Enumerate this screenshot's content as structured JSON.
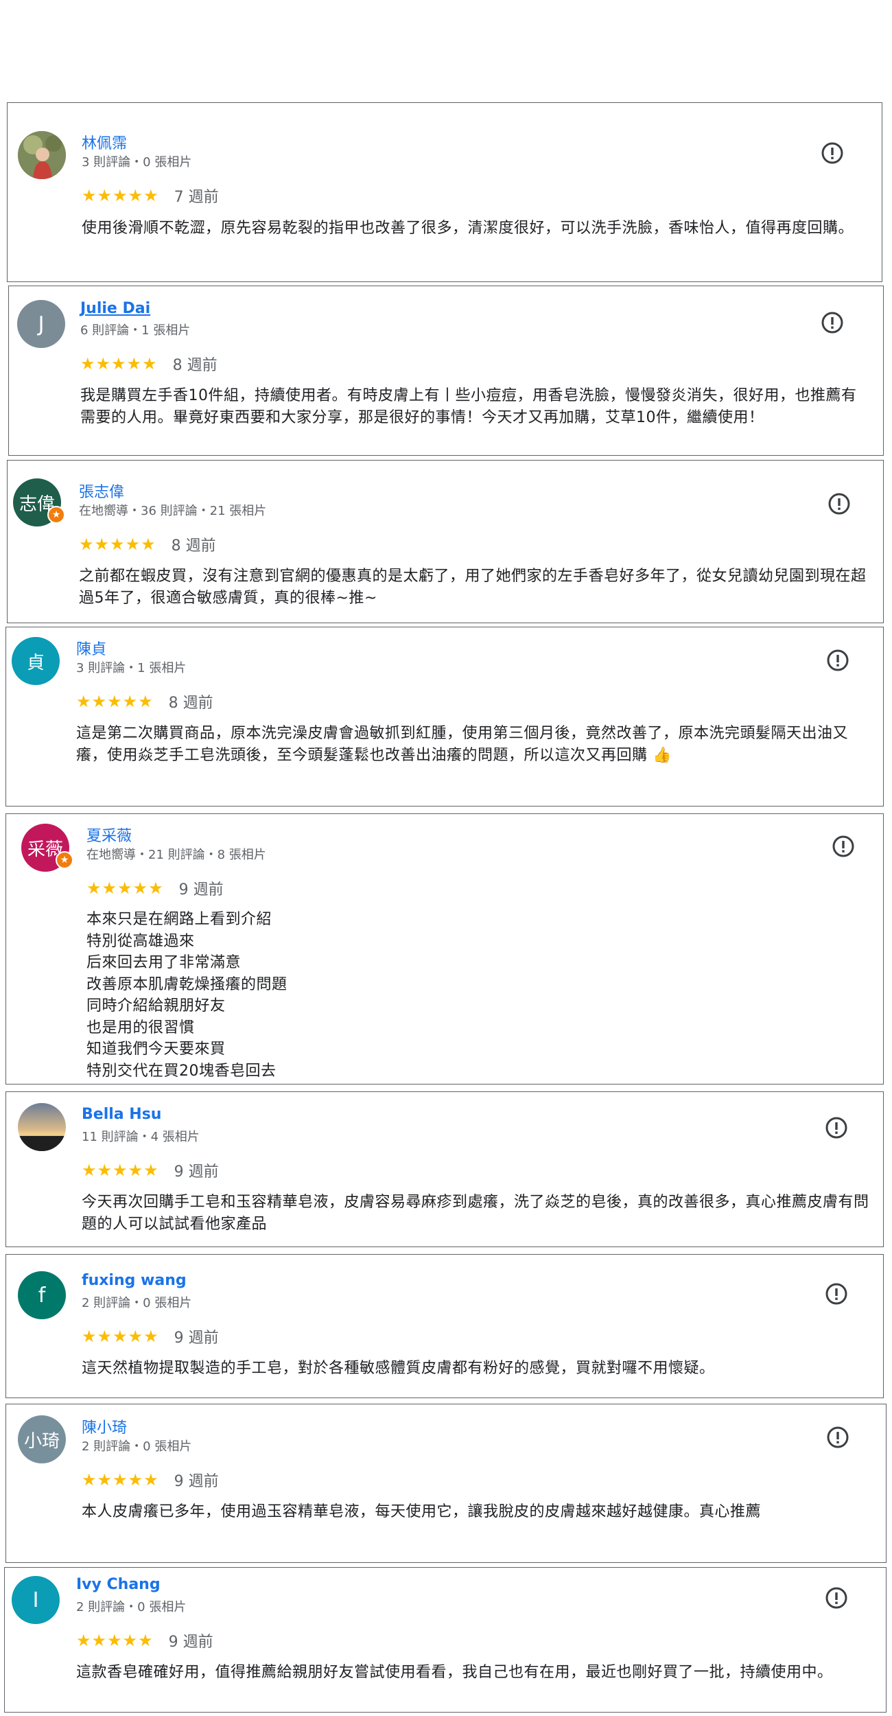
{
  "reviews": [
    {
      "name": "林佩霈",
      "meta": "3 則評論・0 張相片",
      "stars": "★★★★★",
      "time": "7 週前",
      "text": "使用後滑順不乾澀，原先容易乾裂的指甲也改善了很多，清潔度很好，可以洗手洗臉，香味怡人，值得再度回購。",
      "avatar": {
        "type": "photo",
        "icon": "person-photo"
      }
    },
    {
      "name": "Julie Dai",
      "meta": "6 則評論・1 張相片",
      "stars": "★★★★★",
      "time": "8 週前",
      "text": "我是購買左手香10件組，持續使用者。有時皮膚上有丨些小痘痘，用香皂洗臉，慢慢發炎消失，很好用，也推薦有需要的人用。畢竟好東西要和大家分享，那是很好的事情！今天才又再加購，艾草10件，繼續使用！",
      "avatar": {
        "type": "letter",
        "letter": "J",
        "color": "#7b8c97"
      }
    },
    {
      "name": "張志偉",
      "meta": "在地嚮導・36 則評論・21 張相片",
      "stars": "★★★★★",
      "time": "8 週前",
      "text": "之前都在蝦皮買，沒有注意到官網的優惠真的是太虧了，用了她們家的左手香皂好多年了，從女兒讀幼兒園到現在超過5年了，很適合敏感膚質，真的很棒~推~",
      "avatar": {
        "type": "letter",
        "letter": "志偉",
        "color": "#1e5e4b",
        "badge": true
      }
    },
    {
      "name": "陳貞",
      "meta": "3 則評論・1 張相片",
      "stars": "★★★★★",
      "time": "8 週前",
      "text": "這是第二次購買商品，原本洗完澡皮膚會過敏抓到紅腫，使用第三個月後，竟然改善了，原本洗完頭髮隔天出油又癢，使用焱芝手工皂洗頭後，至今頭髮蓬鬆也改善出油癢的問題，所以這次又再回購 👍",
      "avatar": {
        "type": "letter",
        "letter": "貞",
        "color": "#0a9db5"
      }
    },
    {
      "name": "夏采薇",
      "meta": "在地嚮導・21 則評論・8 張相片",
      "stars": "★★★★★",
      "time": "9 週前",
      "lines": [
        "本來只是在網路上看到介紹",
        "特別從高雄過來",
        "后來回去用了非常滿意",
        "改善原本肌膚乾燥搔癢的問題",
        "同時介紹給親朋好友",
        "也是用的很習慣",
        "知道我們今天要來買",
        "特別交代在買20塊香皂回去"
      ],
      "avatar": {
        "type": "letter",
        "letter": "采薇",
        "color": "#c2185b",
        "badge": true
      }
    },
    {
      "name": "Bella Hsu",
      "meta": "11 則評論・4 張相片",
      "stars": "★★★★★",
      "time": "9 週前",
      "text": "今天再次回購手工皂和玉容精華皂液，皮膚容易尋麻疹到處癢，洗了焱芝的皂後，真的改善很多，真心推薦皮膚有問題的人可以試試看他家產品",
      "avatar": {
        "type": "photo",
        "icon": "sunset-photo"
      }
    },
    {
      "name": "fuxing wang",
      "meta": "2 則評論・0 張相片",
      "stars": "★★★★★",
      "time": "9 週前",
      "text": "這天然植物提取製造的手工皂，對於各種敏感體質皮膚都有粉好的感覺，買就對囉不用懷疑。",
      "avatar": {
        "type": "letter",
        "letter": "f",
        "color": "#00796b"
      }
    },
    {
      "name": "陳小琦",
      "meta": "2 則評論・0 張相片",
      "stars": "★★★★★",
      "time": "9 週前",
      "text": "本人皮膚癢已多年，使用過玉容精華皂液，每天使用它，讓我脫皮的皮膚越來越好越健康。真心推薦",
      "avatar": {
        "type": "letter",
        "letter": "小琦",
        "color": "#78909c"
      }
    },
    {
      "name": "Ivy Chang",
      "meta": "2 則評論・0 張相片",
      "stars": "★★★★★",
      "time": "9 週前",
      "text": "這款香皂確確好用，值得推薦給親朋好友嘗試使用看看，我自己也有在用，最近也剛好買了一批，持續使用中。",
      "avatar": {
        "type": "letter",
        "letter": "I",
        "color": "#0a9db5"
      }
    }
  ]
}
